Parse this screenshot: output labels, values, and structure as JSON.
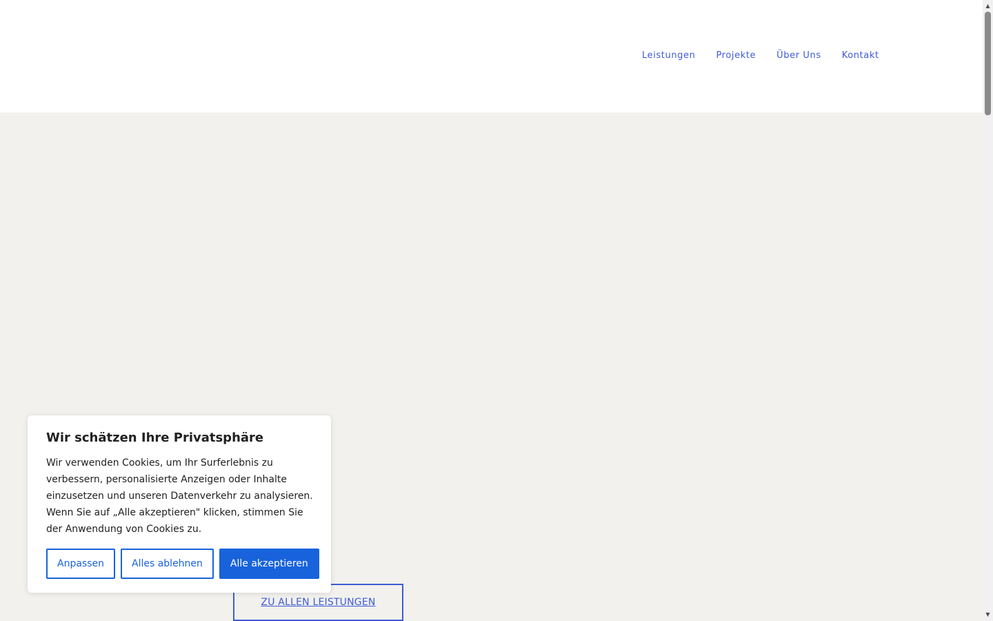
{
  "nav": {
    "items": [
      {
        "label": "Leistungen"
      },
      {
        "label": "Projekte"
      },
      {
        "label": "Über Uns"
      },
      {
        "label": "Kontakt"
      }
    ]
  },
  "hero": {
    "cta_label": "ZU ALLEN LEISTUNGEN"
  },
  "cookie": {
    "title": "Wir schätzen Ihre Privatsphäre",
    "text": "Wir verwenden Cookies, um Ihr Surferlebnis zu verbessern, personalisierte Anzeigen oder Inhalte einzusetzen und unseren Datenverkehr zu analysieren. Wenn Sie auf „Alle akzeptieren\" klicken, stimmen Sie der Anwendung von Cookies zu.",
    "buttons": {
      "customize": "Anpassen",
      "reject": "Alles ablehnen",
      "accept": "Alle akzeptieren"
    }
  },
  "colors": {
    "nav_link": "#3f5bd8",
    "hero_background": "#f2f1ed",
    "cookie_accent": "#1863dc"
  },
  "icons": {
    "scroll_up": "arrow-up-icon",
    "scroll_down": "arrow-down-icon"
  }
}
